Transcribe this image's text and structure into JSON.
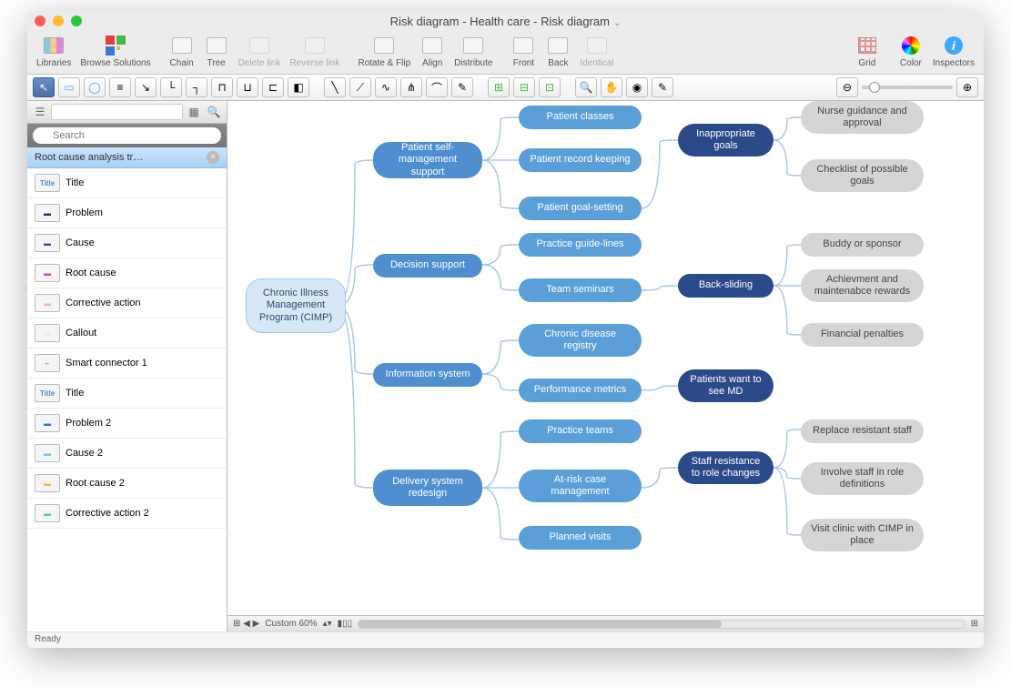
{
  "title": "Risk diagram - Health care - Risk diagram",
  "toolbar": {
    "libraries": "Libraries",
    "browse": "Browse Solutions",
    "chain": "Chain",
    "tree": "Tree",
    "deleteLink": "Delete link",
    "reverseLink": "Reverse link",
    "rotateFlip": "Rotate & Flip",
    "align": "Align",
    "distribute": "Distribute",
    "front": "Front",
    "back": "Back",
    "identical": "Identical",
    "grid": "Grid",
    "color": "Color",
    "inspectors": "Inspectors"
  },
  "sidebar": {
    "searchPlaceholder": "Search",
    "header": "Root cause analysis tr…",
    "items": [
      {
        "label": "Title",
        "swatch": "Title",
        "color": "#5a7fd8"
      },
      {
        "label": "Problem",
        "swatch": "▬",
        "color": "#2a2a6a"
      },
      {
        "label": "Cause",
        "swatch": "▬",
        "color": "#6a3a9a"
      },
      {
        "label": "Root cause",
        "swatch": "▬",
        "color": "#c84aa8"
      },
      {
        "label": "Corrective action",
        "swatch": "▬",
        "color": "#f8a8d8"
      },
      {
        "label": "Callout",
        "swatch": "▭",
        "color": "#f5d5e8"
      },
      {
        "label": "Smart connector 1",
        "swatch": "⌐",
        "color": "#888"
      },
      {
        "label": "Title",
        "swatch": "Title",
        "color": "#5a7fd8"
      },
      {
        "label": "Problem 2",
        "swatch": "▬",
        "color": "#3a6fc8"
      },
      {
        "label": "Cause 2",
        "swatch": "▬",
        "color": "#6ac8e8"
      },
      {
        "label": "Root cause 2",
        "swatch": "▬",
        "color": "#f0b838"
      },
      {
        "label": "Corrective action 2",
        "swatch": "▬",
        "color": "#58c8a8"
      }
    ]
  },
  "diagram": {
    "root": "Chronic Illness Management Program (CIMP)",
    "level2": [
      "Patient self-management support",
      "Decision support",
      "Information system",
      "Delivery system redesign"
    ],
    "leaves": [
      "Patient classes",
      "Patient record keeping",
      "Patient goal-setting",
      "Practice guide-lines",
      "Team seminars",
      "Chronic disease registry",
      "Performance metrics",
      "Practice teams",
      "At-risk case management",
      "Planned visits"
    ],
    "risks": [
      "Inappropriate goals",
      "Back-sliding",
      "Patients want to see MD",
      "Staff resistance to role changes"
    ],
    "actions": [
      "Nurse guidance and approval",
      "Checklist of possible goals",
      "Buddy or sponsor",
      "Achievment and maintenabce rewards",
      "Financial penalties",
      "Replace resistant staff",
      "Involve staff in role definitions",
      "Visit clinic with CIMP in place"
    ]
  },
  "bottomBar": {
    "zoom": "Custom 60%"
  },
  "status": "Ready"
}
